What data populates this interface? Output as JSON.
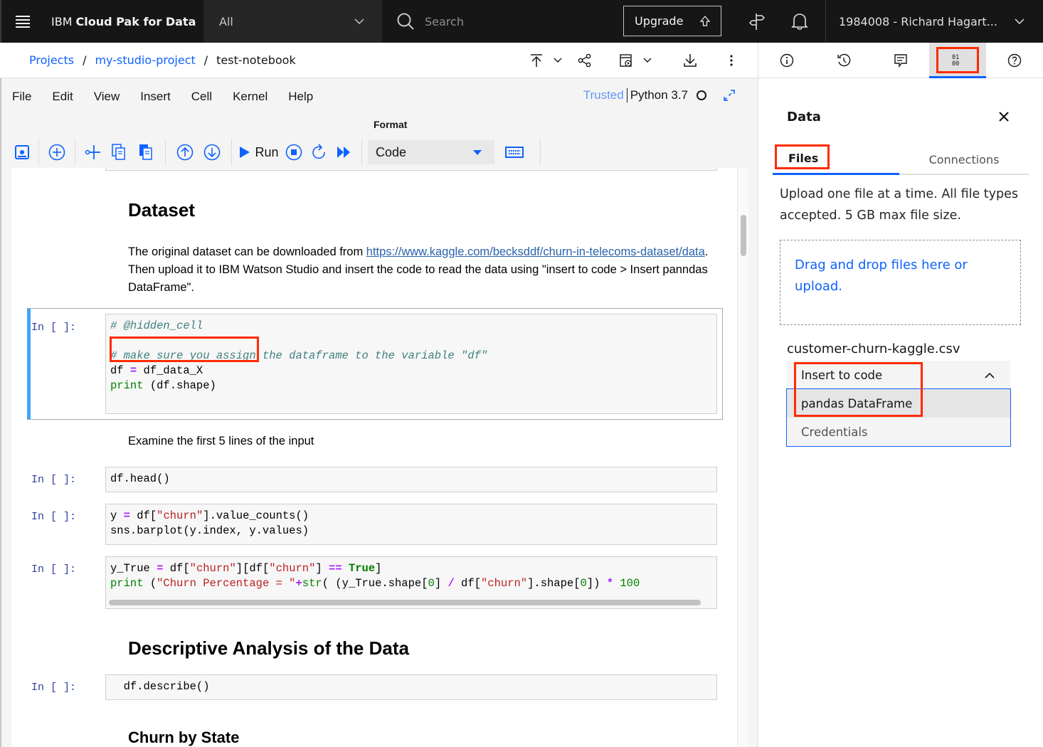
{
  "topbar": {
    "brand_prefix": "IBM",
    "brand_name": "Cloud Pak for Data",
    "scope_value": "All",
    "search_placeholder": "Search",
    "upgrade_label": "Upgrade",
    "account_label": "1984008 - Richard Hagart..."
  },
  "breadcrumb": {
    "items": [
      "Projects",
      "my-studio-project"
    ],
    "current": "test-notebook",
    "separator": "/"
  },
  "notebook": {
    "menu": [
      "File",
      "Edit",
      "View",
      "Insert",
      "Cell",
      "Kernel",
      "Help"
    ],
    "trusted_label": "Trusted",
    "kernel_name": "Python 3.7",
    "format_label": "Format",
    "cell_type": "Code",
    "run_label": "Run",
    "prompt": "In [ ]:",
    "cells": {
      "dataset_heading": "Dataset",
      "dataset_text_before": "The original dataset can be downloaded from ",
      "dataset_link": "https://www.kaggle.com/becksddf/churn-in-telecoms-dataset/data",
      "dataset_text_after": ". Then upload it to IBM Watson Studio and insert the code to read the data using \"insert to code > Insert panndas DataFrame\".",
      "code1_comment1": "# @hidden_cell",
      "code1_comment2": "# make sure you assign the dataframe to the variable \"df\"",
      "code1_line3_a": "df ",
      "code1_line3_op": "=",
      "code1_line3_b": " df_data_X",
      "code1_line4_kw": "print",
      "code1_line4_rest": " (df.shape)",
      "examine_text": "Examine the first 5 lines of the input",
      "code2": "df.head()",
      "code3_l1_a": "y ",
      "code3_l1_op": "=",
      "code3_l1_b": " df[",
      "code3_l1_str": "\"churn\"",
      "code3_l1_c": "].value_counts()",
      "code3_l2": "sns.barplot(y.index, y.values)",
      "code4_l1_a": "y_True ",
      "code4_l1_op": "=",
      "code4_l1_b": " df[",
      "code4_l1_str1": "\"churn\"",
      "code4_l1_c": "][df[",
      "code4_l1_str2": "\"churn\"",
      "code4_l1_d": "] ",
      "code4_l1_op2": "==",
      "code4_l1_e": " ",
      "code4_l1_true": "True",
      "code4_l1_f": "]",
      "code4_l2_kw": "print",
      "code4_l2_a": " (",
      "code4_l2_str": "\"Churn Percentage = \"",
      "code4_l2_op": "+",
      "code4_l2_kw2": "str",
      "code4_l2_b": "( (y_True.shape[",
      "code4_l2_n1": "0",
      "code4_l2_c": "] ",
      "code4_l2_op2": "/",
      "code4_l2_d": " df[",
      "code4_l2_str2": "\"churn\"",
      "code4_l2_e": "].shape[",
      "code4_l2_n2": "0",
      "code4_l2_f": "]) ",
      "code4_l2_op3": "*",
      "code4_l2_g": " ",
      "code4_l2_n3": "100",
      "descriptive_heading": "Descriptive Analysis of the Data",
      "code5": "  df.describe()",
      "churn_state_heading": "Churn by State"
    }
  },
  "panel": {
    "title": "Data",
    "tabs": [
      "Files",
      "Connections"
    ],
    "description": "Upload one file at a time. All file types accepted. 5 GB max file size.",
    "dropzone_text": "Drag and drop files here or upload.",
    "file_name": "customer-churn-kaggle.csv",
    "insert_label": "Insert to code",
    "options": [
      "pandas DataFrame",
      "Credentials"
    ]
  },
  "colors": {
    "accent": "#0f62fe",
    "highlight_annotation": "#ff2a00",
    "selected_cell_bar": "#42a5f5"
  }
}
